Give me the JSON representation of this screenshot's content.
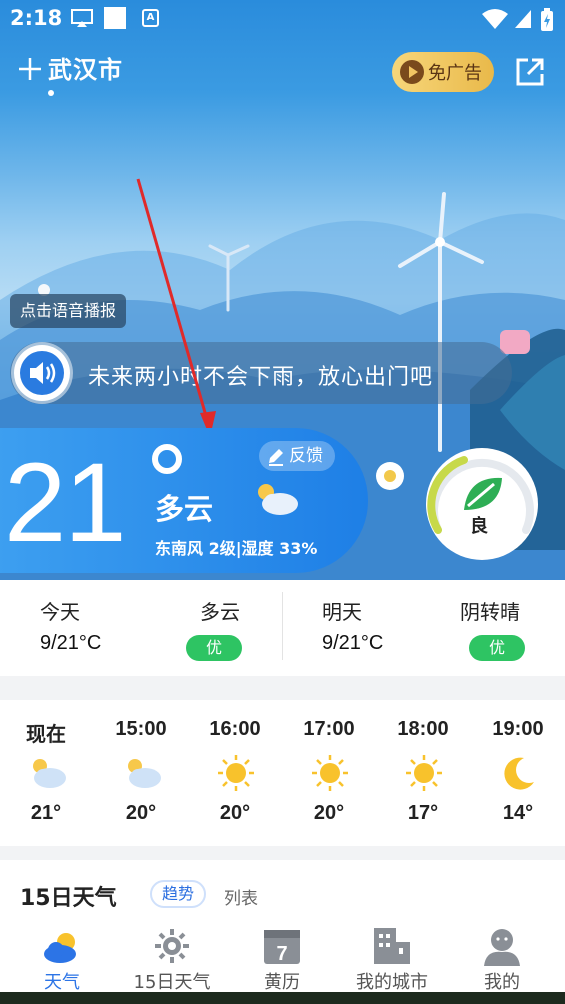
{
  "status_bar": {
    "time": "2:18",
    "badge_letter": "A"
  },
  "header": {
    "city": "武汉市",
    "ad_free_label": "免广告"
  },
  "voice": {
    "tip": "点击语音播报",
    "rain_message": "未来两小时不会下雨，放心出门吧"
  },
  "current": {
    "temperature": "21",
    "condition": "多云",
    "wind_humidity": "东南风 2级|湿度 33%",
    "feedback_label": "反馈",
    "aqi_label": "良"
  },
  "days": [
    {
      "label": "今天",
      "condition": "多云",
      "temp": "9/21°C",
      "quality": "优"
    },
    {
      "label": "明天",
      "condition": "阴转晴",
      "temp": "9/21°C",
      "quality": "优"
    }
  ],
  "hourly": [
    {
      "time": "现在",
      "icon": "partly-cloudy-icon",
      "temp": "21°"
    },
    {
      "time": "15:00",
      "icon": "partly-cloudy-icon",
      "temp": "20°"
    },
    {
      "time": "16:00",
      "icon": "sun-icon",
      "temp": "20°"
    },
    {
      "time": "17:00",
      "icon": "sun-icon",
      "temp": "20°"
    },
    {
      "time": "18:00",
      "icon": "sun-icon",
      "temp": "17°"
    },
    {
      "time": "19:00",
      "icon": "moon-icon",
      "temp": "14°"
    }
  ],
  "forecast_15": {
    "title": "15日天气",
    "tab_trend": "趋势",
    "tab_list": "列表"
  },
  "nav": [
    {
      "label": "天气",
      "icon": "weather-icon",
      "active": true
    },
    {
      "label": "15日天气",
      "icon": "gear-sun-icon",
      "active": false
    },
    {
      "label": "黄历",
      "icon": "calendar-icon",
      "active": false,
      "calendar_day": "7"
    },
    {
      "label": "我的城市",
      "icon": "buildings-icon",
      "active": false
    },
    {
      "label": "我的",
      "icon": "profile-icon",
      "active": false
    }
  ],
  "colors": {
    "primary_blue": "#2c74e6",
    "good_green": "#2ec463",
    "ad_gold": "#e9b94a"
  }
}
